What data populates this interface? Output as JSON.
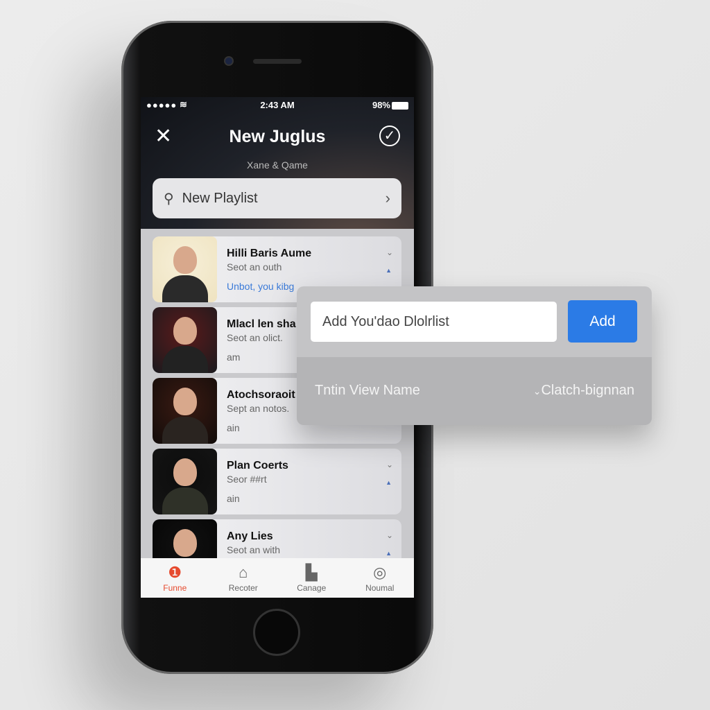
{
  "status": {
    "signal": "●●●●●",
    "wifi": "wifi-icon",
    "time": "2:43 AM",
    "battery": "98%"
  },
  "header": {
    "title": "New Juglus",
    "subtitle": "Xane & Qame",
    "close_icon": "close-icon",
    "confirm_icon": "check-circle-icon"
  },
  "search": {
    "value": "New Playlist"
  },
  "items": [
    {
      "title": "Hilli Baris Aume",
      "sub": "Seot an outh",
      "extra": "Unbot, you kibg",
      "thumb": [
        "#f6efd8",
        "#efe3c0",
        "#2a2a2a"
      ]
    },
    {
      "title": "Mlacl len sha",
      "sub": "Seot an olict.",
      "extra": "am",
      "thumb": [
        "#5a1a1a",
        "#1a1a1e",
        "#222"
      ]
    },
    {
      "title": "Atochsoraoit",
      "sub": "Sept an notos.",
      "extra": "ain",
      "thumb": [
        "#3a1a12",
        "#120c0a",
        "#2a2420"
      ]
    },
    {
      "title": "Plan Coerts",
      "sub": "Seor ##rt",
      "extra": "ain",
      "thumb": [
        "#0c0c0c",
        "#151515",
        "#2f3128"
      ]
    },
    {
      "title": "Any Lies",
      "sub": "Seot an with",
      "extra": "",
      "thumb": [
        "#111",
        "#050505",
        "#222"
      ]
    }
  ],
  "tabs": [
    {
      "label": "Funne",
      "icon": "flame-icon",
      "active": true
    },
    {
      "label": "Recoter",
      "icon": "house-icon"
    },
    {
      "label": "Canage",
      "icon": "library-icon"
    },
    {
      "label": "Noumal",
      "icon": "profile-icon"
    }
  ],
  "popup": {
    "input_value": "Add You'dao Dlolrlist",
    "add_label": "Add",
    "row_label": "Tntin View Name",
    "row_value": "Clatch-bignnan"
  },
  "colors": {
    "accent": "#2b7be6",
    "active_tab": "#e64a2e"
  }
}
